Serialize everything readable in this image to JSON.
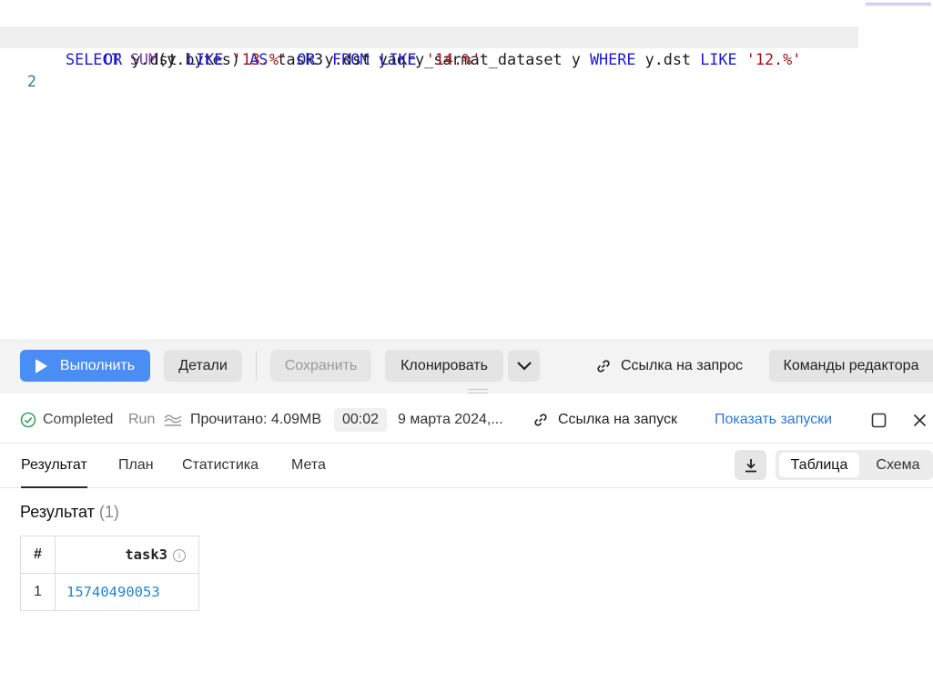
{
  "editor": {
    "line1_number": "1",
    "line2_number": "2",
    "line1": {
      "t1": "SELECT",
      "t2": " ",
      "t3": "SUM",
      "t4": "(y.bytes) ",
      "t5": "AS",
      "t6": " task3 ",
      "t7": "FROM",
      "t8": " yaqry_sarmat_dataset y ",
      "t9": "WHERE",
      "t10": " y.dst ",
      "t11": "LIKE",
      "t12": " ",
      "t13": "'12.%'"
    },
    "line1_wrap": {
      "t1": "OR",
      "t2": " y.dst ",
      "t3": "LIKE",
      "t4": " ",
      "t5": "'13.%'",
      "t6": " ",
      "t7": "OR",
      "t8": " y.dst ",
      "t9": "LIKE",
      "t10": " ",
      "t11": "'14.%'"
    }
  },
  "toolbar": {
    "run_label": "Выполнить",
    "details_label": "Детали",
    "save_label": "Сохранить",
    "clone_label": "Клонировать",
    "query_link_label": "Ссылка на запрос",
    "editor_commands_label": "Команды редактора"
  },
  "status": {
    "state": "Completed",
    "run_label": "Run",
    "read_label": "Прочитано: 4.09MB",
    "duration": "00:02",
    "date": "9 марта 2024,...",
    "run_link_label": "Ссылка на запуск",
    "show_runs_label": "Показать запуски"
  },
  "tabs": {
    "items": [
      "Результат",
      "План",
      "Статистика",
      "Мета"
    ],
    "active": "Результат",
    "view_table": "Таблица",
    "view_schema": "Схема"
  },
  "result": {
    "title": "Результат",
    "count": "(1)",
    "columns": [
      "#",
      "task3"
    ],
    "rows": [
      [
        "1",
        "15740490053"
      ]
    ]
  },
  "colors": {
    "primary": "#4a8ef5",
    "success": "#3aa35f",
    "link": "#2f77d1",
    "value": "#2585c9"
  }
}
